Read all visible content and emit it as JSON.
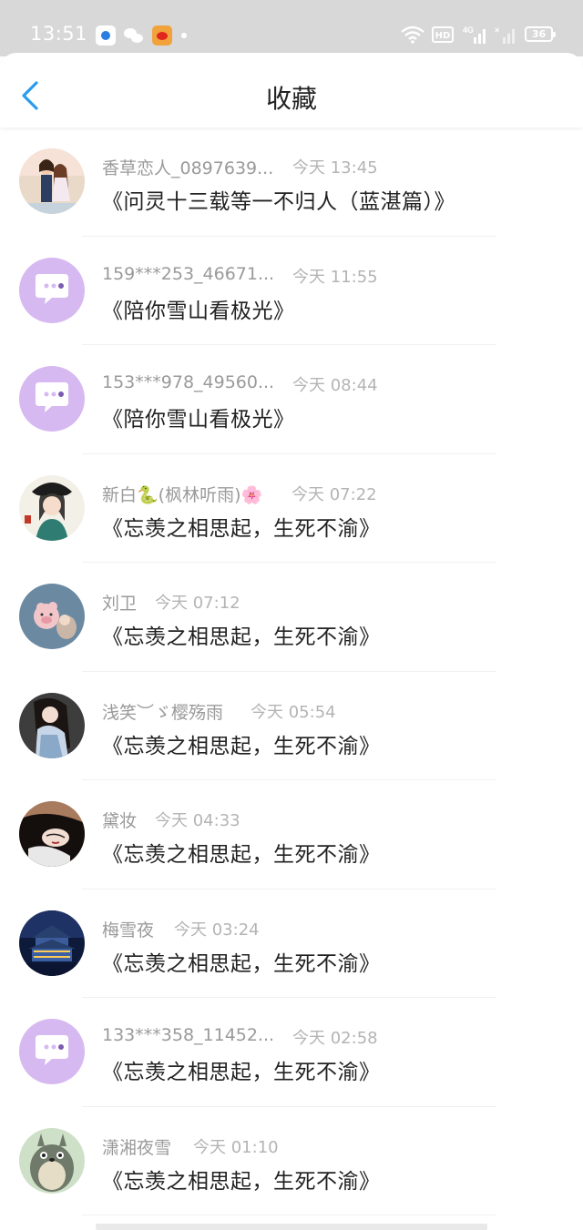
{
  "status_bar": {
    "time": "13:51",
    "hd_label": "HD",
    "battery_level": "36",
    "icons": [
      "qq-icon",
      "wechat-icon",
      "weibo-icon",
      "wifi-icon",
      "signal-icon"
    ]
  },
  "header": {
    "title": "收藏",
    "back_icon": "chevron-left-icon"
  },
  "colors": {
    "accent": "#2a9cf0",
    "default_avatar": "#d7b9f1"
  },
  "favorites": [
    {
      "name": "香草恋人_0897639...",
      "time": "今天 13:45",
      "title": "《问灵十三载等一不归人（蓝湛篇）》",
      "avatar": "photo"
    },
    {
      "name": "159***253_46671...",
      "time": "今天 11:55",
      "title": "《陪你雪山看极光》",
      "avatar": "default"
    },
    {
      "name": "153***978_49560...",
      "time": "今天 08:44",
      "title": "《陪你雪山看极光》",
      "avatar": "default"
    },
    {
      "name": "新白🐍(枫林听雨)🌸",
      "time": "今天 07:22",
      "title": "《忘羡之相思起，生死不渝》",
      "avatar": "photo"
    },
    {
      "name": "刘卫",
      "time": "今天 07:12",
      "title": "《忘羡之相思起，生死不渝》",
      "avatar": "photo"
    },
    {
      "name": "浅笑︶ゞ樱殇雨",
      "time": "今天 05:54",
      "title": "《忘羡之相思起，生死不渝》",
      "avatar": "photo"
    },
    {
      "name": "黛妆",
      "time": "今天 04:33",
      "title": "《忘羡之相思起，生死不渝》",
      "avatar": "photo"
    },
    {
      "name": "梅雪夜",
      "time": "今天 03:24",
      "title": "《忘羡之相思起，生死不渝》",
      "avatar": "photo"
    },
    {
      "name": "133***358_11452...",
      "time": "今天 02:58",
      "title": "《忘羡之相思起，生死不渝》",
      "avatar": "default"
    },
    {
      "name": "潇湘夜雪",
      "time": "今天 01:10",
      "title": "《忘羡之相思起，生死不渝》",
      "avatar": "photo"
    }
  ]
}
